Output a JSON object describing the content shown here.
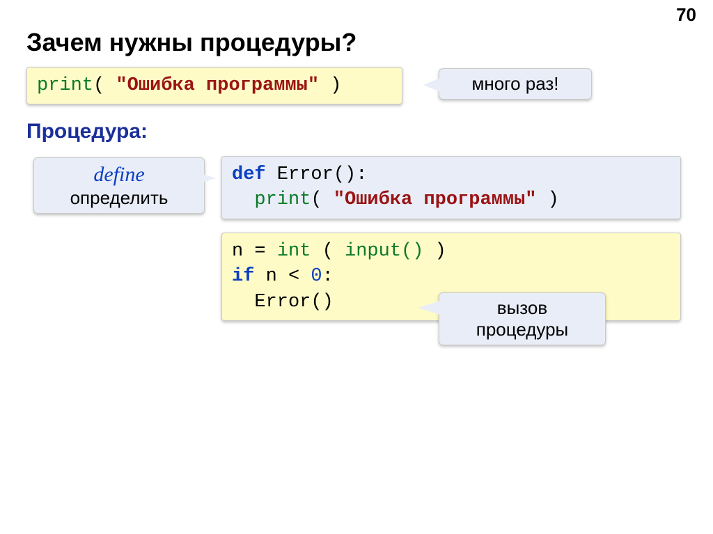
{
  "page_number": "70",
  "title": "Зачем нужны процедуры?",
  "code1": {
    "print": "print",
    "open": "( ",
    "str": "\"Ошибка программы\"",
    "close": " )"
  },
  "callout_many": "много раз!",
  "subhead": "Процедура:",
  "callout_define": {
    "line1": "define",
    "line2": "определить"
  },
  "code2": {
    "l1_def": "def",
    "l1_rest": " Error():",
    "l2_indent": "  ",
    "l2_print": "print",
    "l2_open": "( ",
    "l2_str": "\"Ошибка программы\"",
    "l2_close": " )"
  },
  "code3": {
    "l1a": "n = ",
    "l1_int": "int",
    "l1b": " ( ",
    "l1_input": "input()",
    "l1c": " )",
    "l2_if": "if",
    "l2_rest": " n < ",
    "l2_zero": "0",
    "l2_colon": ":",
    "l3": "  Error()"
  },
  "callout_call": {
    "line1": "вызов",
    "line2": "процедуры"
  }
}
